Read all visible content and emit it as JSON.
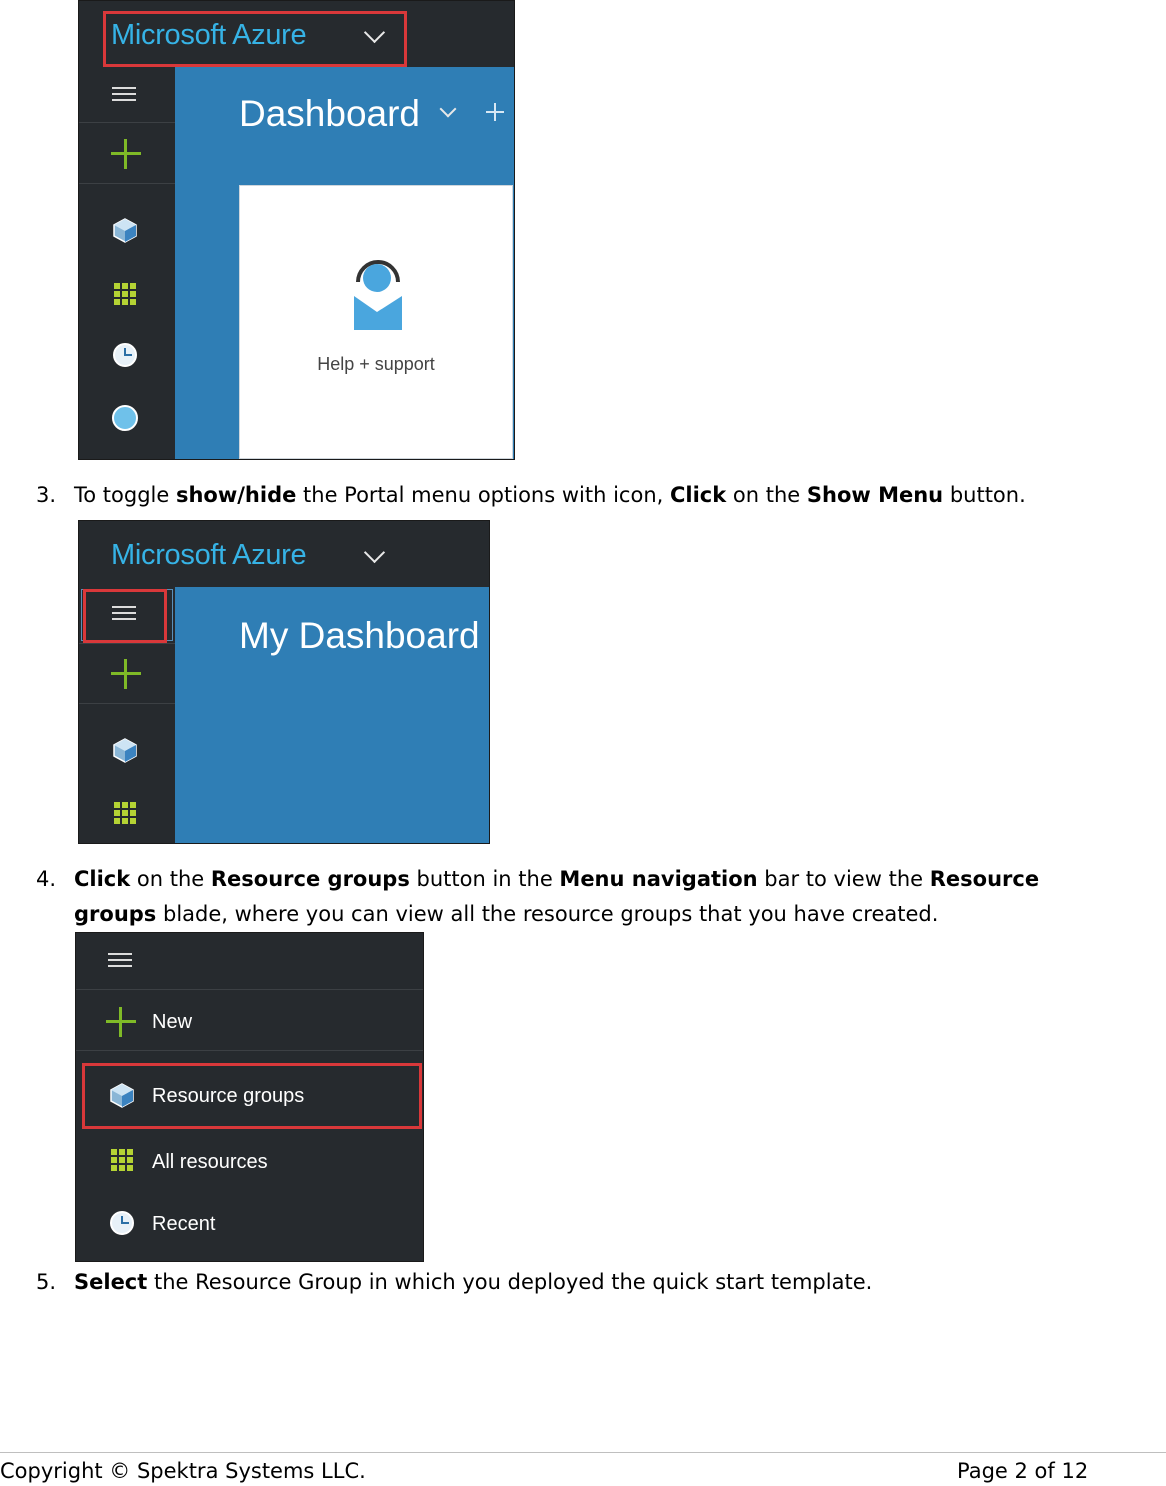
{
  "portal": {
    "brand": "Microsoft Azure",
    "dashboard_title": "Dashboard",
    "my_dashboard_title": "My Dashboard",
    "help_tile_label": "Help + support",
    "menu": {
      "new_label": "New",
      "resource_groups_label": "Resource groups",
      "all_resources_label": "All resources",
      "recent_label": "Recent"
    },
    "colors": {
      "brand_text": "#36b3e6",
      "nav_background": "#262a2e",
      "dashboard_blue": "#2f7eb5",
      "highlight_box": "#d9383a",
      "plus_green": "#7fba27"
    }
  },
  "steps": [
    {
      "number": "3.",
      "line1": [
        {
          "text": "To toggle ",
          "bold": false
        },
        {
          "text": "show/hide",
          "bold": true
        },
        {
          "text": " the Portal menu options with icon, ",
          "bold": false
        },
        {
          "text": "Click",
          "bold": true
        },
        {
          "text": " on the ",
          "bold": false
        },
        {
          "text": "Show Menu",
          "bold": true
        },
        {
          "text": " button.",
          "bold": false
        }
      ]
    },
    {
      "number": "4.",
      "line1": [
        {
          "text": "Click",
          "bold": true
        },
        {
          "text": " on the ",
          "bold": false
        },
        {
          "text": "Resource groups",
          "bold": true
        },
        {
          "text": " button in the ",
          "bold": false
        },
        {
          "text": "Menu navigation",
          "bold": true
        },
        {
          "text": " bar to view the ",
          "bold": false
        },
        {
          "text": "Resource",
          "bold": true
        }
      ],
      "line2": [
        {
          "text": "groups",
          "bold": true
        },
        {
          "text": " blade, where you can view all the resource groups that you have created.",
          "bold": false
        }
      ]
    },
    {
      "number": "5.",
      "line1": [
        {
          "text": "Select",
          "bold": true
        },
        {
          "text": " the Resource Group in which you deployed the quick start template.",
          "bold": false
        }
      ]
    }
  ],
  "footer": {
    "copyright": "Copyright © Spektra Systems LLC.",
    "page": "Page 2 of 12"
  }
}
